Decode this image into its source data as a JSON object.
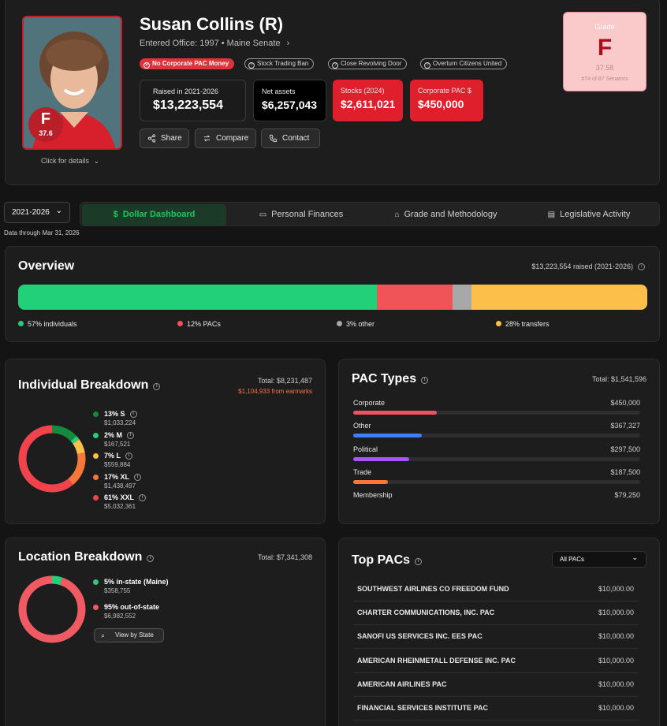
{
  "profile": {
    "name": "Susan Collins (R)",
    "subtitle": "Entered Office: 1997 • Maine Senate",
    "grade_letter": "F",
    "grade_score": "37.6",
    "click_details": "Click for details",
    "pills": [
      "No Corporate PAC Money",
      "Stock Trading Ban",
      "Close Revolving Door",
      "Overturn Citizens United"
    ],
    "stats": [
      {
        "label": "Raised in 2021-2026",
        "value": "$13,223,554"
      },
      {
        "label": "Net assets",
        "value": "$6,257,043"
      },
      {
        "label": "Stocks (2024)",
        "value": "$2,611,021"
      },
      {
        "label": "Corporate PAC $",
        "value": "$450,000"
      }
    ],
    "buttons": [
      "Share",
      "Compare",
      "Contact"
    ]
  },
  "grade_box": {
    "title": "Grade",
    "letter": "F",
    "score": "37.58",
    "rank": "#74 of 87 Senators"
  },
  "period": {
    "selected": "2021-2026",
    "data_through": "Data through Mar 31, 2026"
  },
  "tabs": [
    "Dollar Dashboard",
    "Personal Finances",
    "Grade and Methodology",
    "Legislative Activity"
  ],
  "overview": {
    "title": "Overview",
    "raised_label": "$13,223,554 raised (2021-2026)",
    "segments": [
      {
        "label": "57% individuals",
        "pct": 57,
        "color": "#22d07a"
      },
      {
        "label": "12% PACs",
        "pct": 12,
        "color": "#f05358"
      },
      {
        "label": "3% other",
        "pct": 3,
        "color": "#a8a8a8"
      },
      {
        "label": "28% transfers",
        "pct": 28,
        "color": "#fbbf4a"
      }
    ]
  },
  "individual": {
    "title": "Individual Breakdown",
    "total": "Total: $8,231,487",
    "earmarks": "$1,104,933 from earmarks",
    "items": [
      {
        "label": "13% S",
        "amount": "$1,033,224",
        "pct": 13,
        "color": "#168a3c"
      },
      {
        "label": "2% M",
        "amount": "$167,521",
        "pct": 2,
        "color": "#22d07a"
      },
      {
        "label": "7% L",
        "amount": "$559,884",
        "pct": 7,
        "color": "#fbbf4a"
      },
      {
        "label": "17% XL",
        "amount": "$1,438,497",
        "pct": 17,
        "color": "#f7773a"
      },
      {
        "label": "61% XXL",
        "amount": "$5,032,361",
        "pct": 61,
        "color": "#f0434b"
      }
    ]
  },
  "pac_types": {
    "title": "PAC Types",
    "total": "Total: $1,541,596",
    "items": [
      {
        "label": "Corporate",
        "amount": "$450,000",
        "fraction": 0.29,
        "color": "#f05358"
      },
      {
        "label": "Other",
        "amount": "$367,327",
        "fraction": 0.24,
        "color": "#3b82f6"
      },
      {
        "label": "Political",
        "amount": "$297,500",
        "fraction": 0.195,
        "color": "#a855f7"
      },
      {
        "label": "Trade",
        "amount": "$187,500",
        "fraction": 0.12,
        "color": "#f7773a"
      },
      {
        "label": "Membership",
        "amount": "$79,250",
        "fraction": 0.05,
        "color": "#22d07a"
      }
    ]
  },
  "location": {
    "title": "Location Breakdown",
    "total": "Total: $7,341,308",
    "items": [
      {
        "label": "5% in-state (Maine)",
        "amount": "$358,755",
        "pct": 5,
        "color": "#22d07a"
      },
      {
        "label": "95% out-of-state",
        "amount": "$6,982,552",
        "pct": 95,
        "color": "#f05a62"
      }
    ],
    "view_button": "View by State"
  },
  "top_pacs": {
    "title": "Top PACs",
    "filter": "All PACs",
    "rows": [
      {
        "name": "SOUTHWEST AIRLINES CO FREEDOM FUND",
        "amount": "$10,000.00"
      },
      {
        "name": "CHARTER COMMUNICATIONS, INC. PAC",
        "amount": "$10,000.00"
      },
      {
        "name": "SANOFI US SERVICES INC. EES PAC",
        "amount": "$10,000.00"
      },
      {
        "name": "AMERICAN RHEINMETALL DEFENSE INC. PAC",
        "amount": "$10,000.00"
      },
      {
        "name": "AMERICAN AIRLINES PAC",
        "amount": "$10,000.00"
      },
      {
        "name": "FINANCIAL SERVICES INSTITUTE PAC",
        "amount": "$10,000.00"
      }
    ]
  }
}
